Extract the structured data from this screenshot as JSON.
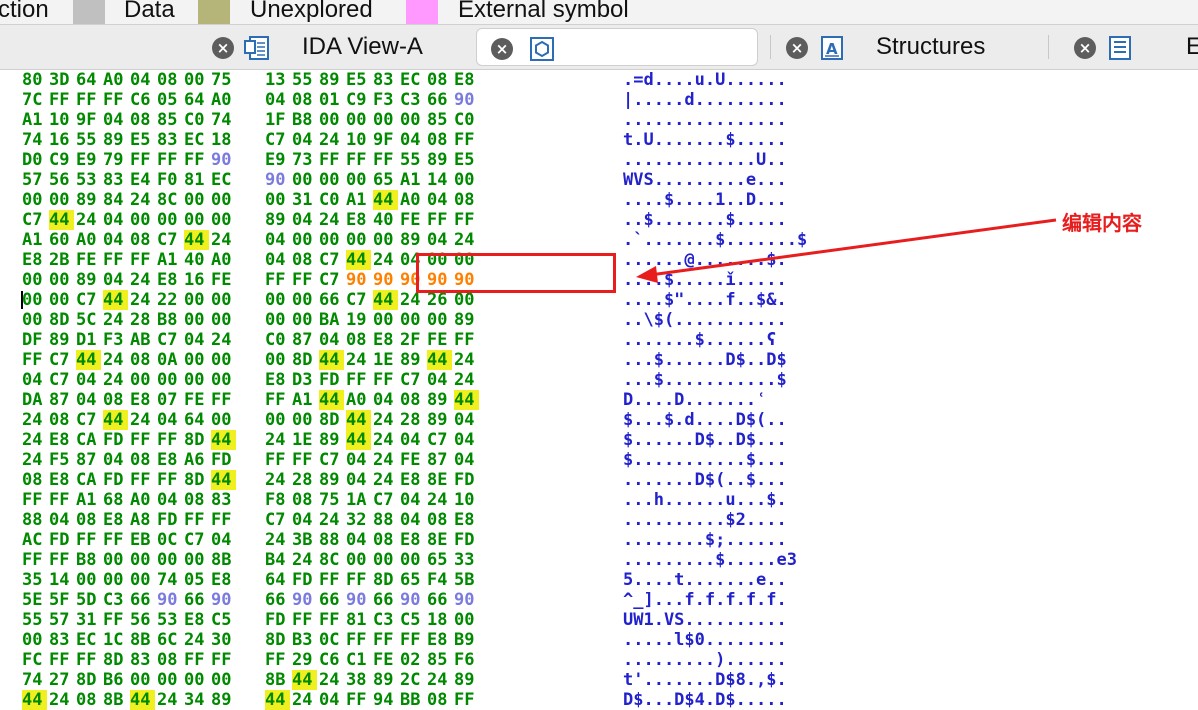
{
  "legend": {
    "items": [
      {
        "label": "ction",
        "color": "#f3f3f3"
      },
      {
        "label": "Data",
        "color": "#c0c0c0"
      },
      {
        "label": "Unexplored",
        "color": "#b5b57a"
      },
      {
        "label": "External symbol",
        "color": "#ff99ff"
      }
    ]
  },
  "tabs": [
    {
      "label": "IDA View-A",
      "icon": "disassembly-view-icon",
      "active": false
    },
    {
      "label": "",
      "icon": "hex-view-icon",
      "active": true
    },
    {
      "label": "Structures",
      "icon": "structures-icon",
      "active": false
    },
    {
      "label": "E",
      "icon": "enums-icon",
      "active": false
    }
  ],
  "hex_rows": [
    {
      "bytes": [
        "80",
        "3D",
        "64",
        "A0",
        "04",
        "08",
        "00",
        "75",
        "13",
        "55",
        "89",
        "E5",
        "83",
        "EC",
        "08",
        "E8"
      ],
      "ascii": ".=d....u.U......"
    },
    {
      "bytes": [
        "7C",
        "FF",
        "FF",
        "FF",
        "C6",
        "05",
        "64",
        "A0",
        "04",
        "08",
        "01",
        "C9",
        "F3",
        "C3",
        "66",
        "90"
      ],
      "ascii": "|.....d........."
    },
    {
      "bytes": [
        "A1",
        "10",
        "9F",
        "04",
        "08",
        "85",
        "C0",
        "74",
        "1F",
        "B8",
        "00",
        "00",
        "00",
        "00",
        "85",
        "C0"
      ],
      "ascii": "................"
    },
    {
      "bytes": [
        "74",
        "16",
        "55",
        "89",
        "E5",
        "83",
        "EC",
        "18",
        "C7",
        "04",
        "24",
        "10",
        "9F",
        "04",
        "08",
        "FF"
      ],
      "ascii": "t.U.......$....."
    },
    {
      "bytes": [
        "D0",
        "C9",
        "E9",
        "79",
        "FF",
        "FF",
        "FF",
        "90",
        "E9",
        "73",
        "FF",
        "FF",
        "FF",
        "55",
        "89",
        "E5"
      ],
      "ascii": ".............U.."
    },
    {
      "bytes": [
        "57",
        "56",
        "53",
        "83",
        "E4",
        "F0",
        "81",
        "EC",
        "90",
        "00",
        "00",
        "00",
        "65",
        "A1",
        "14",
        "00"
      ],
      "ascii": "WVS.........e..."
    },
    {
      "bytes": [
        "00",
        "00",
        "89",
        "84",
        "24",
        "8C",
        "00",
        "00",
        "00",
        "31",
        "C0",
        "A1",
        "44",
        "A0",
        "04",
        "08"
      ],
      "ascii": "....$....1..D..."
    },
    {
      "bytes": [
        "C7",
        "44",
        "24",
        "04",
        "00",
        "00",
        "00",
        "00",
        "89",
        "04",
        "24",
        "E8",
        "40",
        "FE",
        "FF",
        "FF"
      ],
      "ascii": "..$.......$....."
    },
    {
      "bytes": [
        "A1",
        "60",
        "A0",
        "04",
        "08",
        "C7",
        "44",
        "24",
        "04",
        "00",
        "00",
        "00",
        "00",
        "89",
        "04",
        "24"
      ],
      "ascii": ".`.......$.......$"
    },
    {
      "bytes": [
        "E8",
        "2B",
        "FE",
        "FF",
        "FF",
        "A1",
        "40",
        "A0",
        "04",
        "08",
        "C7",
        "44",
        "24",
        "04",
        "00",
        "00"
      ],
      "ascii": "......@.......$."
    },
    {
      "bytes": [
        "00",
        "00",
        "89",
        "04",
        "24",
        "E8",
        "16",
        "FE",
        "FF",
        "FF",
        "C7",
        "90",
        "90",
        "90",
        "90",
        "90"
      ],
      "ascii": "....$.....ǐ....."
    },
    {
      "bytes": [
        "00",
        "00",
        "C7",
        "44",
        "24",
        "22",
        "00",
        "00",
        "00",
        "00",
        "66",
        "C7",
        "44",
        "24",
        "26",
        "00"
      ],
      "ascii": "....$\"....f..$&."
    },
    {
      "bytes": [
        "00",
        "8D",
        "5C",
        "24",
        "28",
        "B8",
        "00",
        "00",
        "00",
        "00",
        "BA",
        "19",
        "00",
        "00",
        "00",
        "89"
      ],
      "ascii": "..\\$(..........."
    },
    {
      "bytes": [
        "DF",
        "89",
        "D1",
        "F3",
        "AB",
        "C7",
        "04",
        "24",
        "C0",
        "87",
        "04",
        "08",
        "E8",
        "2F",
        "FE",
        "FF"
      ],
      "ascii": ".......$......ʕ"
    },
    {
      "bytes": [
        "FF",
        "C7",
        "44",
        "24",
        "08",
        "0A",
        "00",
        "00",
        "00",
        "8D",
        "44",
        "24",
        "1E",
        "89",
        "44",
        "24"
      ],
      "ascii": "...$......D$..D$"
    },
    {
      "bytes": [
        "04",
        "C7",
        "04",
        "24",
        "00",
        "00",
        "00",
        "00",
        "E8",
        "D3",
        "FD",
        "FF",
        "FF",
        "C7",
        "04",
        "24"
      ],
      "ascii": "...$...........$"
    },
    {
      "bytes": [
        "DA",
        "87",
        "04",
        "08",
        "E8",
        "07",
        "FE",
        "FF",
        "FF",
        "A1",
        "44",
        "A0",
        "04",
        "08",
        "89",
        "44"
      ],
      "ascii": "D....D.......ʿ"
    },
    {
      "bytes": [
        "24",
        "08",
        "C7",
        "44",
        "24",
        "04",
        "64",
        "00",
        "00",
        "00",
        "8D",
        "44",
        "24",
        "28",
        "89",
        "04"
      ],
      "ascii": "$...$.d....D$(.."
    },
    {
      "bytes": [
        "24",
        "E8",
        "CA",
        "FD",
        "FF",
        "FF",
        "8D",
        "44",
        "24",
        "1E",
        "89",
        "44",
        "24",
        "04",
        "C7",
        "04"
      ],
      "ascii": "$......D$..D$..."
    },
    {
      "bytes": [
        "24",
        "F5",
        "87",
        "04",
        "08",
        "E8",
        "A6",
        "FD",
        "FF",
        "FF",
        "C7",
        "04",
        "24",
        "FE",
        "87",
        "04"
      ],
      "ascii": "$...........$..."
    },
    {
      "bytes": [
        "08",
        "E8",
        "CA",
        "FD",
        "FF",
        "FF",
        "8D",
        "44",
        "24",
        "28",
        "89",
        "04",
        "24",
        "E8",
        "8E",
        "FD"
      ],
      "ascii": ".......D$(..$..."
    },
    {
      "bytes": [
        "FF",
        "FF",
        "A1",
        "68",
        "A0",
        "04",
        "08",
        "83",
        "F8",
        "08",
        "75",
        "1A",
        "C7",
        "04",
        "24",
        "10"
      ],
      "ascii": "...h......u...$."
    },
    {
      "bytes": [
        "88",
        "04",
        "08",
        "E8",
        "A8",
        "FD",
        "FF",
        "FF",
        "C7",
        "04",
        "24",
        "32",
        "88",
        "04",
        "08",
        "E8"
      ],
      "ascii": "..........$2...."
    },
    {
      "bytes": [
        "AC",
        "FD",
        "FF",
        "FF",
        "EB",
        "0C",
        "C7",
        "04",
        "24",
        "3B",
        "88",
        "04",
        "08",
        "E8",
        "8E",
        "FD"
      ],
      "ascii": "........$;......"
    },
    {
      "bytes": [
        "FF",
        "FF",
        "B8",
        "00",
        "00",
        "00",
        "00",
        "8B",
        "B4",
        "24",
        "8C",
        "00",
        "00",
        "00",
        "65",
        "33"
      ],
      "ascii": ".........$.....e3"
    },
    {
      "bytes": [
        "35",
        "14",
        "00",
        "00",
        "00",
        "74",
        "05",
        "E8",
        "64",
        "FD",
        "FF",
        "FF",
        "8D",
        "65",
        "F4",
        "5B"
      ],
      "ascii": "5....t.......e.."
    },
    {
      "bytes": [
        "5E",
        "5F",
        "5D",
        "C3",
        "66",
        "90",
        "66",
        "90",
        "66",
        "90",
        "66",
        "90",
        "66",
        "90",
        "66",
        "90"
      ],
      "ascii": "^_]...f.f.f.f.f."
    },
    {
      "bytes": [
        "55",
        "57",
        "31",
        "FF",
        "56",
        "53",
        "E8",
        "C5",
        "FD",
        "FF",
        "FF",
        "81",
        "C3",
        "C5",
        "18",
        "00"
      ],
      "ascii": "UW1.VS.........."
    },
    {
      "bytes": [
        "00",
        "83",
        "EC",
        "1C",
        "8B",
        "6C",
        "24",
        "30",
        "8D",
        "B3",
        "0C",
        "FF",
        "FF",
        "FF",
        "E8",
        "B9"
      ],
      "ascii": ".....l$0........"
    },
    {
      "bytes": [
        "FC",
        "FF",
        "FF",
        "8D",
        "83",
        "08",
        "FF",
        "FF",
        "FF",
        "29",
        "C6",
        "C1",
        "FE",
        "02",
        "85",
        "F6"
      ],
      "ascii": ".........)......"
    },
    {
      "bytes": [
        "74",
        "27",
        "8D",
        "B6",
        "00",
        "00",
        "00",
        "00",
        "8B",
        "44",
        "24",
        "38",
        "89",
        "2C",
        "24",
        "89"
      ],
      "ascii": "t'.......D$8.,$."
    },
    {
      "bytes": [
        "44",
        "24",
        "08",
        "8B",
        "44",
        "24",
        "34",
        "89",
        "44",
        "24",
        "04",
        "FF",
        "94",
        "BB",
        "08",
        "FF"
      ],
      "ascii": "D$...D$4.D$....."
    }
  ],
  "highlight_byte": "44",
  "nop_byte": "90",
  "annotation": {
    "label": "编辑内容",
    "color": "#e81d1d"
  }
}
